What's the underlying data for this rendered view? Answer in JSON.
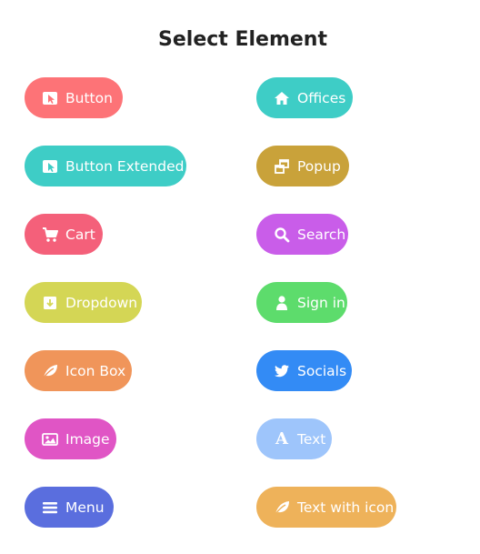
{
  "title": "Select Element",
  "buttons": [
    {
      "id": "button",
      "label": "Button",
      "icon": "cursor-icon",
      "color": "#fd7377"
    },
    {
      "id": "offices",
      "label": "Offices",
      "icon": "home-icon",
      "color": "#3ecdc6"
    },
    {
      "id": "button-extended",
      "label": "Button Extended",
      "icon": "cursor-icon",
      "color": "#3ecdc6"
    },
    {
      "id": "popup",
      "label": "Popup",
      "icon": "windows-icon",
      "color": "#c9a23a"
    },
    {
      "id": "cart",
      "label": "Cart",
      "icon": "cart-icon",
      "color": "#f4607a"
    },
    {
      "id": "search",
      "label": "Search",
      "icon": "search-icon",
      "color": "#c95de9"
    },
    {
      "id": "dropdown",
      "label": "Dropdown",
      "icon": "download-box-icon",
      "color": "#d4d655"
    },
    {
      "id": "sign-in",
      "label": "Sign in",
      "icon": "user-icon",
      "color": "#5ddc6c"
    },
    {
      "id": "icon-box",
      "label": "Icon Box",
      "icon": "leaf-icon",
      "color": "#f0955a"
    },
    {
      "id": "socials",
      "label": "Socials",
      "icon": "twitter-bird-icon",
      "color": "#338bf5"
    },
    {
      "id": "image",
      "label": "Image",
      "icon": "image-icon",
      "color": "#e055c5"
    },
    {
      "id": "text",
      "label": "Text",
      "icon": "text-a-icon",
      "color": "#9ec5fb"
    },
    {
      "id": "menu",
      "label": "Menu",
      "icon": "hamburger-icon",
      "color": "#5a6ede"
    },
    {
      "id": "text-with-icon",
      "label": "Text with icon",
      "icon": "leaf-icon",
      "color": "#eeb25a"
    }
  ]
}
